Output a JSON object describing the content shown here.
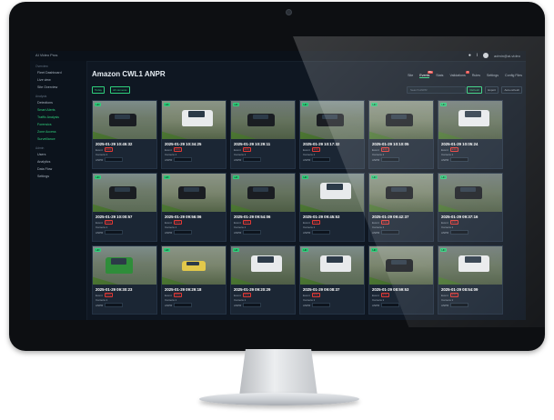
{
  "app": {
    "name": "AI Video Pros",
    "title": "Amazon CWL1 ANPR",
    "user": "admin@ai-video"
  },
  "sidebar": {
    "sections": [
      {
        "label": "Overview",
        "items": [
          "Fleet Dashboard",
          "Live view",
          "Site Overview"
        ]
      },
      {
        "label": "Analysis",
        "items": [
          "Detections",
          "Smart Alerts",
          "Traffic Analysis",
          "Forensics",
          "Zone Access",
          "Surveillance"
        ]
      },
      {
        "label": "Admin",
        "items": [
          "Users",
          "Analytics",
          "Data Flow",
          "Settings"
        ]
      }
    ],
    "active_item": "Smart Alerts"
  },
  "tabs": [
    {
      "label": "Site",
      "active": false,
      "badge": ""
    },
    {
      "label": "Events",
      "active": true,
      "badge": "99+"
    },
    {
      "label": "Stats",
      "active": false,
      "badge": ""
    },
    {
      "label": "Validations",
      "active": false,
      "badge": "3"
    },
    {
      "label": "Rules",
      "active": false,
      "badge": ""
    },
    {
      "label": "Settings",
      "active": false,
      "badge": ""
    },
    {
      "label": "Config Files",
      "active": false,
      "badge": ""
    }
  ],
  "filters": {
    "chip1": "Today",
    "chip2": "All cameras",
    "search_placeholder": "Search ANPR",
    "btn1": "Refresh",
    "btn2": "Export",
    "btn3": "Auto-refresh"
  },
  "event_labels": {
    "event": "Event",
    "camera": "Camera",
    "anpr": "ANPR",
    "tag": "HD",
    "event_value": "Entry"
  },
  "events": [
    {
      "ts": "2025-01-29 10:45:32",
      "camera": "1",
      "car": "dark"
    },
    {
      "ts": "2025-01-29 10:34:25",
      "camera": "1",
      "car": "white"
    },
    {
      "ts": "2025-01-29 10:29:11",
      "camera": "1",
      "car": "dark"
    },
    {
      "ts": "2025-01-29 10:17:32",
      "camera": "1",
      "car": "dark"
    },
    {
      "ts": "2025-01-29 10:10:05",
      "camera": "1",
      "car": "dark"
    },
    {
      "ts": "2025-01-29 10:05:24",
      "camera": "1",
      "car": "white"
    },
    {
      "ts": "2025-01-29 10:00:57",
      "camera": "1",
      "car": "dark"
    },
    {
      "ts": "2025-01-29 09:56:06",
      "camera": "1",
      "car": "dark"
    },
    {
      "ts": "2025-01-29 09:54:06",
      "camera": "1",
      "car": "dark"
    },
    {
      "ts": "2025-01-29 09:45:53",
      "camera": "1",
      "car": "white"
    },
    {
      "ts": "2025-01-29 09:42:37",
      "camera": "1",
      "car": "dark"
    },
    {
      "ts": "2025-01-29 09:37:16",
      "camera": "1",
      "car": "dark"
    },
    {
      "ts": "2025-01-29 09:30:23",
      "camera": "1",
      "car": "green"
    },
    {
      "ts": "2025-01-29 09:29:18",
      "camera": "1",
      "car": "yellow"
    },
    {
      "ts": "2025-01-29 09:20:29",
      "camera": "1",
      "car": "white"
    },
    {
      "ts": "2025-01-29 09:08:37",
      "camera": "1",
      "car": "white"
    },
    {
      "ts": "2025-01-29 08:59:53",
      "camera": "1",
      "car": "dark"
    },
    {
      "ts": "2025-01-29 08:54:09",
      "camera": "1",
      "car": "white"
    }
  ],
  "colors": {
    "accent": "#2fd07c",
    "alert": "#e53935",
    "background": "#0f1722"
  }
}
